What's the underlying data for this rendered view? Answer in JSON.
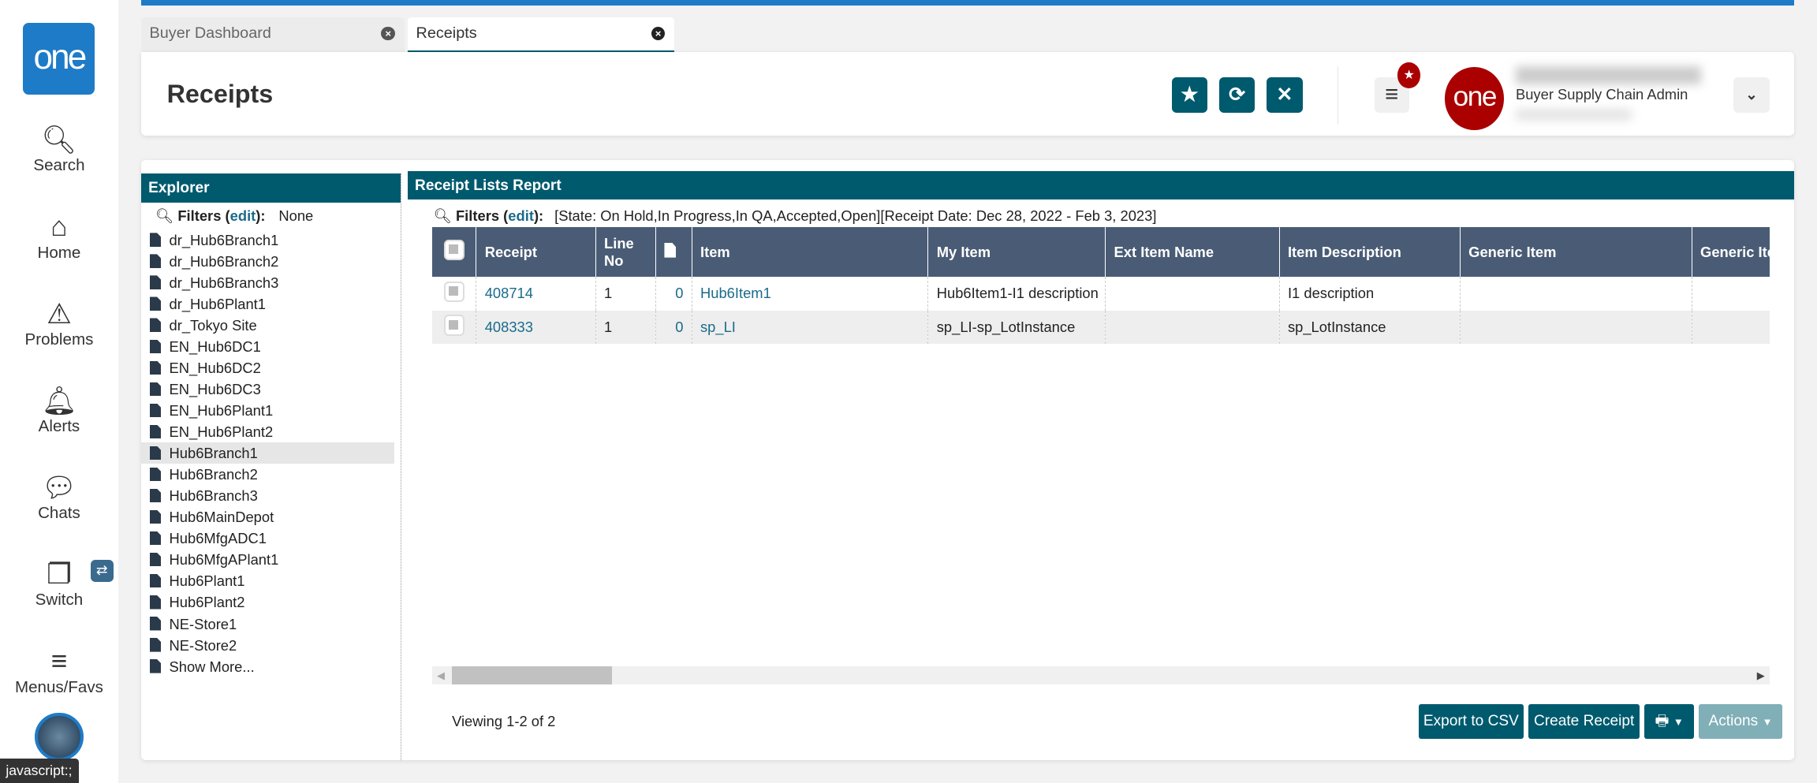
{
  "sidebar": {
    "logo": "one",
    "items": [
      {
        "label": "Search"
      },
      {
        "label": "Home"
      },
      {
        "label": "Problems"
      },
      {
        "label": "Alerts"
      },
      {
        "label": "Chats"
      },
      {
        "label": "Switch"
      },
      {
        "label": "Menus/Favs"
      }
    ],
    "tooltip": "javascript:;"
  },
  "tabs": [
    {
      "label": "Buyer Dashboard"
    },
    {
      "label": "Receipts"
    }
  ],
  "header": {
    "title": "Receipts",
    "role": "Buyer Supply Chain Admin",
    "logo": "one"
  },
  "explorer": {
    "title": "Explorer",
    "filters_label": "Filters",
    "edit": "edit",
    "filters_value": "None",
    "items": [
      "dr_Hub6Branch1",
      "dr_Hub6Branch2",
      "dr_Hub6Branch3",
      "dr_Hub6Plant1",
      "dr_Tokyo Site",
      "EN_Hub6DC1",
      "EN_Hub6DC2",
      "EN_Hub6DC3",
      "EN_Hub6Plant1",
      "EN_Hub6Plant2",
      "Hub6Branch1",
      "Hub6Branch2",
      "Hub6Branch3",
      "Hub6MainDepot",
      "Hub6MfgADC1",
      "Hub6MfgAPlant1",
      "Hub6Plant1",
      "Hub6Plant2",
      "NE-Store1",
      "NE-Store2",
      "Show More..."
    ],
    "selected": "Hub6Branch1"
  },
  "report": {
    "title": "Receipt Lists Report",
    "filters_label": "Filters",
    "edit": "edit",
    "filters_value": "[State: On Hold,In Progress,In QA,Accepted,Open][Receipt Date: Dec 28, 2022 - Feb 3, 2023]",
    "columns": [
      "Receipt",
      "Line No",
      "",
      "Item",
      "My Item",
      "Ext Item Name",
      "Item Description",
      "Generic Item",
      "Generic Item"
    ],
    "rows": [
      {
        "receipt": "408714",
        "line_no": "1",
        "docs": "0",
        "item": "Hub6Item1",
        "my_item": "Hub6Item1-I1 description",
        "ext_item_name": "",
        "item_description": "I1 description",
        "generic_item": "",
        "generic_item2": ""
      },
      {
        "receipt": "408333",
        "line_no": "1",
        "docs": "0",
        "item": "sp_LI",
        "my_item": "sp_LI-sp_LotInstance",
        "ext_item_name": "",
        "item_description": "sp_LotInstance",
        "generic_item": "",
        "generic_item2": ""
      }
    ],
    "viewing": "Viewing 1-2 of 2",
    "buttons": {
      "export": "Export to CSV",
      "create": "Create Receipt",
      "actions": "Actions"
    }
  }
}
